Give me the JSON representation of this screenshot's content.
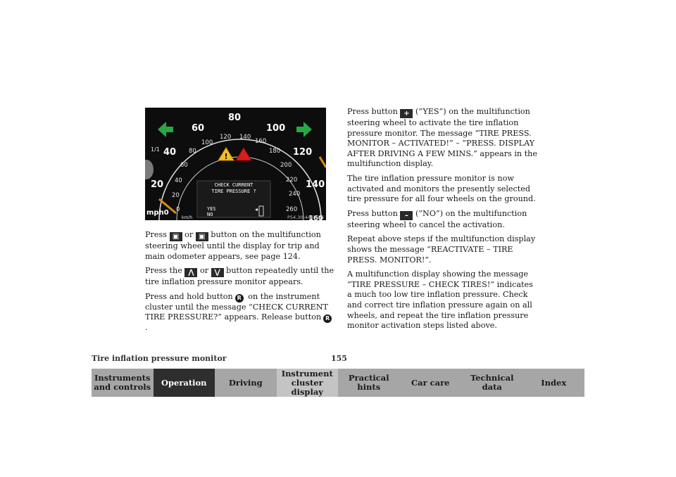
{
  "figure": {
    "ref": "P54.30-4487-26",
    "speedo_mph": [
      "mph0",
      "20",
      "40",
      "60",
      "80",
      "100",
      "120",
      "140"
    ],
    "speedo_kmh": [
      "0",
      "20",
      "40",
      "60",
      "80",
      "100",
      "120",
      "140",
      "160",
      "180",
      "200",
      "220",
      "240",
      "260"
    ],
    "kmh_label": "km/h",
    "display_line1": "CHECK CURRENT",
    "display_line2": "TIRE PRESSURE ?",
    "display_yes": "YES",
    "display_no": "NO",
    "tick_partial_1": "1/1",
    "tick_partial_2": "160"
  },
  "left_column": {
    "p1a": "Press ",
    "p1b": " or ",
    "p1c": " button on the multifunction steering wheel until the display for trip and main odometer appears, see page 124.",
    "p2a": "Press the ",
    "p2b": " or ",
    "p2c": " button repeatedly until the tire inflation pressure monitor appears.",
    "p3a": "Press and hold button",
    "p3b": " on the instrument cluster until the message “CHECK CURRENT TIRE PRESSURE?” appears. Release button",
    "p3c": "."
  },
  "right_column": {
    "p1a": "Press button ",
    "p1b": " (“YES”) on the multifunction steering wheel to activate the tire inflation pressure monitor. The message “TIRE PRESS. MONITOR – ACTIVATED!” – “PRESS. DISPLAY AFTER DRIVING A FEW MINS.” appears in the multifunction display.",
    "p2": "The tire inflation pressure monitor is now activated and monitors the presently selected tire pressure for all four wheels on the ground.",
    "p3a": "Press button ",
    "p3b": " (“NO”) on the multifunction steering wheel to cancel the activation.",
    "p4": "Repeat above steps if the multifunction display shows the message “REACTIVATE – TIRE PRESS. MONITOR!”.",
    "p5": "A multifunction display showing the message “TIRE PRESSURE – CHECK TIRES!” indicates a much too low tire inflation pressure. Check and correct tire inflation pressure again on all wheels, and repeat the tire inflation pressure monitor activation steps listed above."
  },
  "buttons": {
    "reset": "R",
    "plus": "+",
    "minus": "–"
  },
  "footer": {
    "title": "Tire inflation pressure monitor",
    "page": "155"
  },
  "nav": {
    "tabs": [
      {
        "label": "Instruments\nand controls",
        "bg": "#a6a6a6",
        "fg": "#1a1a1a"
      },
      {
        "label": "Operation",
        "bg": "#2e2e2e",
        "fg": "#ffffff"
      },
      {
        "label": "Driving",
        "bg": "#a6a6a6",
        "fg": "#1a1a1a"
      },
      {
        "label": "Instrument\ncluster display",
        "bg": "#c4c4c4",
        "fg": "#1a1a1a"
      },
      {
        "label": "Practical hints",
        "bg": "#a6a6a6",
        "fg": "#1a1a1a"
      },
      {
        "label": "Car care",
        "bg": "#a6a6a6",
        "fg": "#1a1a1a"
      },
      {
        "label": "Technical\ndata",
        "bg": "#a6a6a6",
        "fg": "#1a1a1a"
      },
      {
        "label": "Index",
        "bg": "#a6a6a6",
        "fg": "#1a1a1a"
      }
    ]
  }
}
